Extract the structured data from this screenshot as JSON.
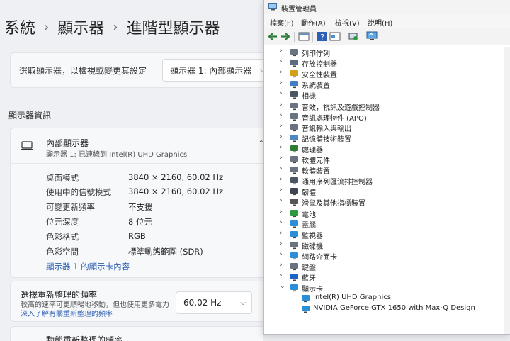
{
  "settings": {
    "breadcrumb": [
      "系統",
      "顯示器",
      "進階型顯示器"
    ],
    "select_label": "選取顯示器，以檢視或變更其設定",
    "select_value": "顯示器 1: 內部顯示器",
    "section_title": "顯示器資訊",
    "display": {
      "name": "內部顯示器",
      "subtitle": "顯示器 1: 已連線到 Intel(R) UHD Graphics",
      "properties": [
        {
          "key": "桌面模式",
          "value": "3840 × 2160, 60.02 Hz"
        },
        {
          "key": "使用中的信號模式",
          "value": "3840 × 2160, 60.02 Hz"
        },
        {
          "key": "可變更新頻率",
          "value": "不支援"
        },
        {
          "key": "位元深度",
          "value": "8 位元"
        },
        {
          "key": "色彩格式",
          "value": "RGB"
        },
        {
          "key": "色彩空間",
          "value": "標準動態範圍 (SDR)"
        }
      ],
      "adapter_link": "顯示器 1 的顯示卡內容"
    },
    "refresh": {
      "title": "選擇重新整理的頻率",
      "desc": "較高的速率可更順暢地移動，但也使用更多電力",
      "link": "深入了解有關重新整理的頻率",
      "value": "60.02 Hz"
    },
    "dynamic_title": "動態重新整理的頻率"
  },
  "devmgr": {
    "title": "裝置管理員",
    "menu": [
      "檔案(F)",
      "動作(A)",
      "檢視(V)",
      "說明(H)"
    ],
    "categories": [
      {
        "label": "列印佇列",
        "icon": "printer-icon"
      },
      {
        "label": "存放控制器",
        "icon": "storage-controller-icon"
      },
      {
        "label": "安全性裝置",
        "icon": "security-device-icon"
      },
      {
        "label": "系統裝置",
        "icon": "system-device-icon"
      },
      {
        "label": "相機",
        "icon": "camera-icon"
      },
      {
        "label": "音效，視訊及遊戲控制器",
        "icon": "audio-icon"
      },
      {
        "label": "音訊處理物件 (APO)",
        "icon": "audio-icon"
      },
      {
        "label": "音訊輸入與輸出",
        "icon": "audio-icon"
      },
      {
        "label": "記憶體技術裝置",
        "icon": "memory-device-icon"
      },
      {
        "label": "處理器",
        "icon": "processor-icon"
      },
      {
        "label": "軟體元件",
        "icon": "software-component-icon"
      },
      {
        "label": "軟體裝置",
        "icon": "software-device-icon"
      },
      {
        "label": "通用序列匯流排控制器",
        "icon": "usb-icon"
      },
      {
        "label": "韌體",
        "icon": "firmware-icon"
      },
      {
        "label": "滑鼠及其他指標裝置",
        "icon": "mouse-icon"
      },
      {
        "label": "電池",
        "icon": "battery-icon"
      },
      {
        "label": "電腦",
        "icon": "computer-icon"
      },
      {
        "label": "監視器",
        "icon": "monitor-icon"
      },
      {
        "label": "磁碟機",
        "icon": "disk-drive-icon"
      },
      {
        "label": "網路介面卡",
        "icon": "network-adapter-icon"
      },
      {
        "label": "鍵盤",
        "icon": "keyboard-icon"
      },
      {
        "label": "藍牙",
        "icon": "bluetooth-icon"
      },
      {
        "label": "顯示卡",
        "icon": "display-adapter-icon"
      }
    ],
    "display_adapters": [
      "Intel(R) UHD Graphics",
      "NVIDIA GeForce GTX 1650 with Max-Q Design"
    ],
    "colors": {
      "accent": "#2a5db0",
      "icon_blue": "#2a8fd6"
    }
  }
}
